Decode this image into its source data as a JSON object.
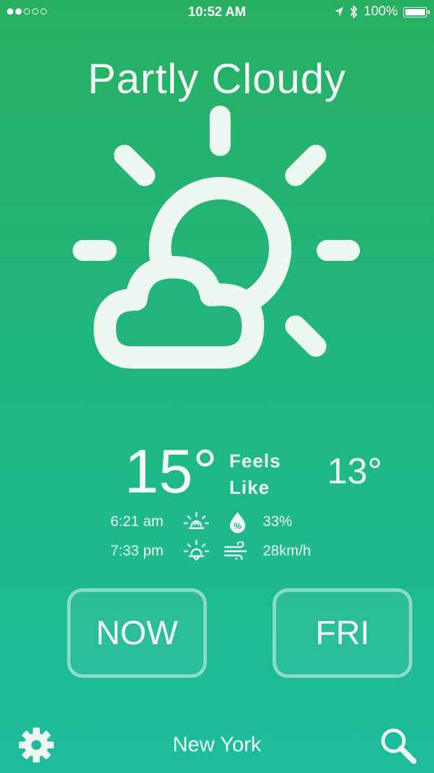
{
  "status_bar": {
    "signal_dots_filled": 2,
    "signal_dots_total": 5,
    "time": "10:52 AM",
    "battery_label": "100%",
    "battery_level": 1.0,
    "icons": [
      "location-arrow-icon",
      "bluetooth-icon",
      "battery-icon"
    ]
  },
  "weather": {
    "condition": "Partly Cloudy",
    "condition_icon": "partly-cloudy-icon",
    "temperature": "15°",
    "feels_like_label_line1": "Feels",
    "feels_like_label_line2": "Like",
    "feels_like_value": "13°",
    "sunrise": "6:21 am",
    "sunset": "7:33 pm",
    "humidity": "33%",
    "wind": "28km/h"
  },
  "buttons": {
    "now_label": "NOW",
    "day_label": "FRI"
  },
  "footer": {
    "city": "New York",
    "settings_icon": "gear-icon",
    "search_icon": "search-icon"
  },
  "colors": {
    "gradient_top": "#28b062",
    "gradient_bottom": "#1dbc9c",
    "foreground": "#eef8f3"
  }
}
